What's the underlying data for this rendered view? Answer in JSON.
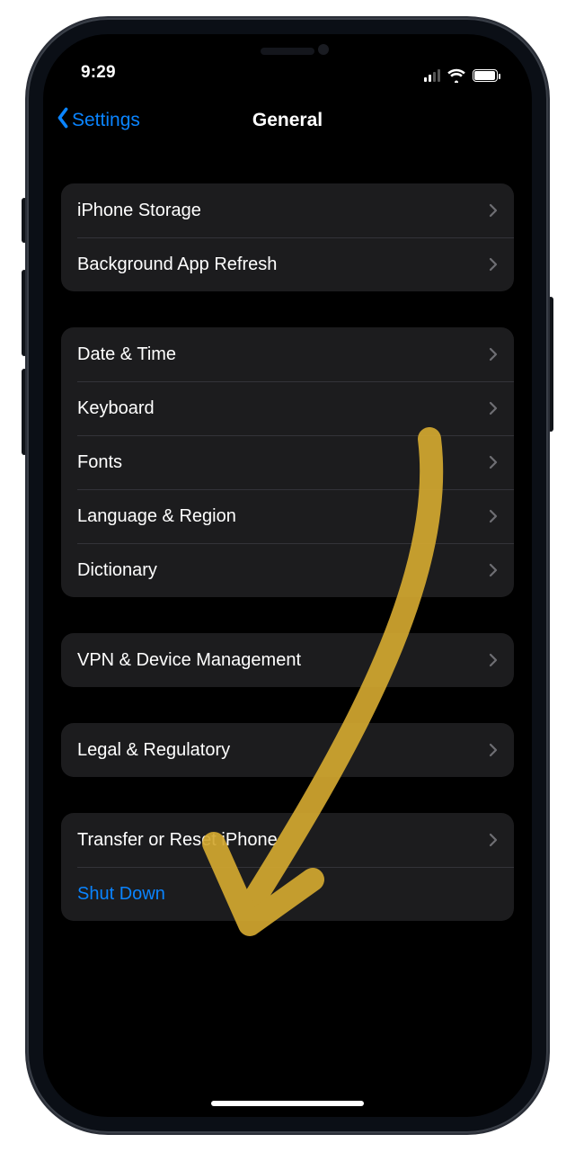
{
  "status": {
    "time": "9:29"
  },
  "nav": {
    "back_label": "Settings",
    "title": "General"
  },
  "groups": [
    {
      "rows": [
        {
          "label": "iPhone Storage",
          "type": "nav"
        },
        {
          "label": "Background App Refresh",
          "type": "nav"
        }
      ]
    },
    {
      "rows": [
        {
          "label": "Date & Time",
          "type": "nav"
        },
        {
          "label": "Keyboard",
          "type": "nav"
        },
        {
          "label": "Fonts",
          "type": "nav"
        },
        {
          "label": "Language & Region",
          "type": "nav"
        },
        {
          "label": "Dictionary",
          "type": "nav"
        }
      ]
    },
    {
      "rows": [
        {
          "label": "VPN & Device Management",
          "type": "nav"
        }
      ]
    },
    {
      "rows": [
        {
          "label": "Legal & Regulatory",
          "type": "nav"
        }
      ]
    },
    {
      "rows": [
        {
          "label": "Transfer or Reset iPhone",
          "type": "nav"
        },
        {
          "label": "Shut Down",
          "type": "link"
        }
      ]
    }
  ],
  "annotation": {
    "color": "#d3a830",
    "target": "Transfer or Reset iPhone"
  }
}
